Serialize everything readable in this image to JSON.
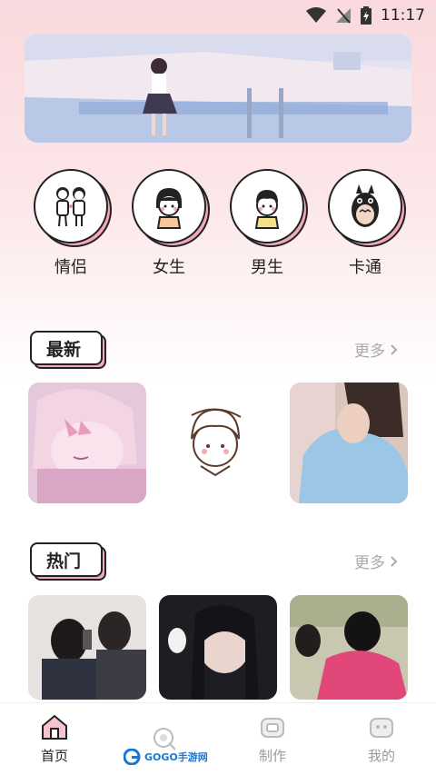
{
  "status": {
    "time": "11:17"
  },
  "categories": [
    {
      "label": "情侣",
      "icon": "couple-icon"
    },
    {
      "label": "女生",
      "icon": "girl-icon"
    },
    {
      "label": "男生",
      "icon": "boy-icon"
    },
    {
      "label": "卡通",
      "icon": "totoro-icon"
    }
  ],
  "latest": {
    "title": "最新",
    "more": "更多"
  },
  "hot": {
    "title": "热门",
    "more": "更多"
  },
  "tabbar": {
    "home": "首页",
    "make": "制作",
    "mine": "我的"
  },
  "watermark": "GOGO手游网",
  "colors": {
    "accent": "#f3a8b8",
    "outline": "#222222"
  }
}
